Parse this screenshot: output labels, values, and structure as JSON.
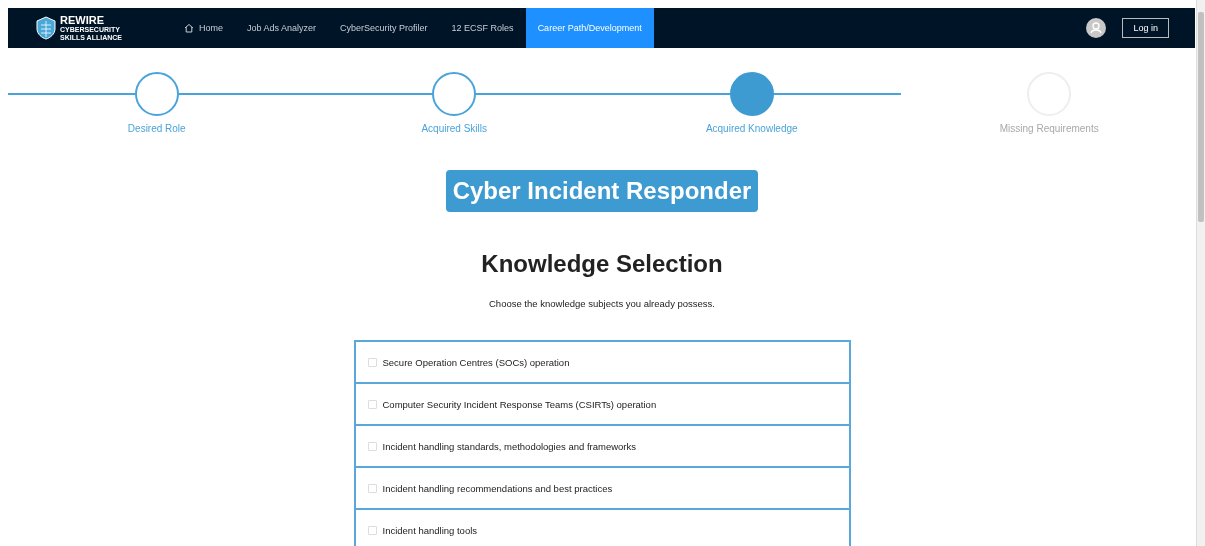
{
  "navbar": {
    "logo": {
      "name": "REWIRE",
      "tagline": "CYBERSECURITY SKILLS ALLIANCE"
    },
    "links": [
      {
        "label": "Home",
        "kind": "home",
        "selected": false
      },
      {
        "label": "Job Ads Analyzer",
        "kind": "plain",
        "selected": false
      },
      {
        "label": "CyberSecurity Profiler",
        "kind": "plain",
        "selected": false
      },
      {
        "label": "12 ECSF Roles",
        "kind": "plain",
        "selected": false
      },
      {
        "label": "Career Path/Development",
        "kind": "plain",
        "selected": true
      }
    ],
    "login_button": "Log in"
  },
  "steps": [
    {
      "label": "Desired Role",
      "completed": true,
      "selected": false
    },
    {
      "label": "Acquired Skills",
      "completed": true,
      "selected": false
    },
    {
      "label": "Acquired Knowledge",
      "completed": true,
      "selected": true
    },
    {
      "label": "Missing Requirements",
      "completed": false,
      "selected": false
    }
  ],
  "role_title": "Cyber Incident Responder",
  "heading": "Knowledge Selection",
  "instruction": "Choose the knowledge subjects you already possess.",
  "knowledge_items": [
    {
      "label": "Secure Operation Centres (SOCs) operation",
      "checked": false
    },
    {
      "label": "Computer Security Incident Response Teams (CSIRTs) operation",
      "checked": false
    },
    {
      "label": "Incident handling standards, methodologies and frameworks",
      "checked": false
    },
    {
      "label": "Incident handling recommendations and best practices",
      "checked": false
    },
    {
      "label": "Incident handling tools",
      "checked": false
    }
  ]
}
